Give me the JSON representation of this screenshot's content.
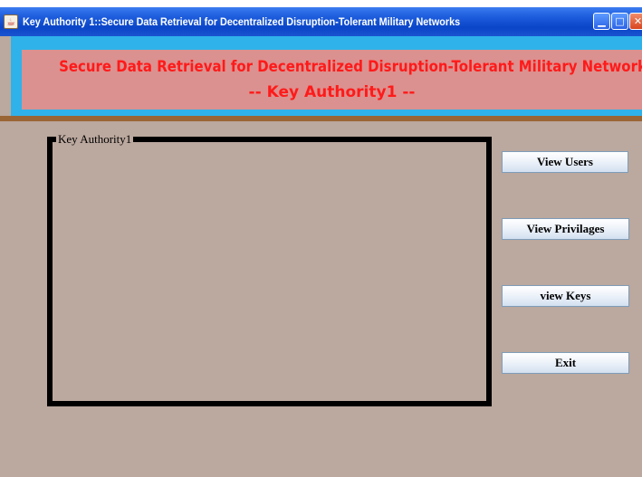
{
  "window": {
    "title": "Key Authority 1::Secure Data Retrieval for Decentralized Disruption-Tolerant Military Networks",
    "app_icon": "java-coffee-icon",
    "controls": {
      "minimize_icon": "minimize-icon",
      "maximize_icon": "maximize-icon",
      "close_icon": "close-icon"
    }
  },
  "banner": {
    "line1": "Secure Data Retrieval for Decentralized Disruption-Tolerant Military Networks",
    "line2": "-- Key Authority1 --"
  },
  "panel": {
    "title": "Key Authority1"
  },
  "buttons": {
    "view_users": "View Users",
    "view_privilages": "View Privilages",
    "view_keys": "view Keys",
    "exit": "Exit"
  },
  "colors": {
    "window_background": "#bba89e",
    "title_bar": "#0a45c8",
    "banner_border": "#2fb2ea",
    "banner_fill": "#db918f",
    "banner_text": "#ff1a1a",
    "divider": "#9a6535"
  }
}
